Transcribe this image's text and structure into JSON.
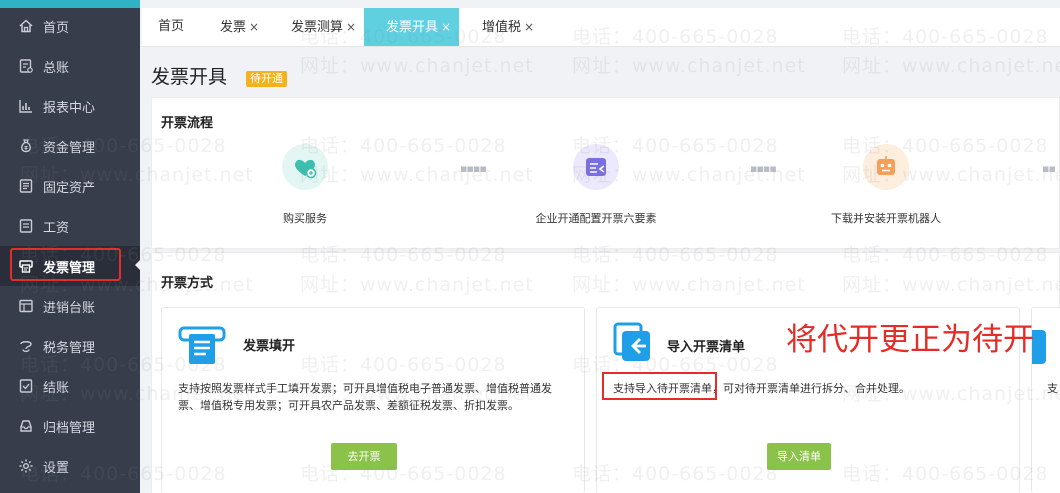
{
  "sidebar": {
    "items": [
      {
        "label": "首页",
        "icon": "home-icon"
      },
      {
        "label": "总账",
        "icon": "ledger-icon"
      },
      {
        "label": "报表中心",
        "icon": "report-chart-icon"
      },
      {
        "label": "资金管理",
        "icon": "money-bag-icon"
      },
      {
        "label": "固定资产",
        "icon": "asset-icon"
      },
      {
        "label": "工资",
        "icon": "salary-icon"
      },
      {
        "label": "发票管理",
        "icon": "invoice-printer-icon",
        "active": true
      },
      {
        "label": "进销台账",
        "icon": "stock-ledger-icon"
      },
      {
        "label": "税务管理",
        "icon": "tax-icon"
      },
      {
        "label": "结账",
        "icon": "closing-icon"
      },
      {
        "label": "归档管理",
        "icon": "archive-icon"
      },
      {
        "label": "设置",
        "icon": "gear-icon"
      }
    ]
  },
  "tabs": [
    {
      "label": "首页",
      "closable": false
    },
    {
      "label": "发票",
      "closable": true
    },
    {
      "label": "发票测算",
      "closable": true
    },
    {
      "label": "发票开具",
      "closable": true,
      "active": true
    },
    {
      "label": "增值税",
      "closable": true
    }
  ],
  "tab_close_glyph": "×",
  "page": {
    "title": "发票开具",
    "status_badge": "待开通"
  },
  "process": {
    "title": "开票流程",
    "steps": [
      {
        "label": "购买服务",
        "icon": "heart-shield-icon",
        "color": "#3bbfae"
      },
      {
        "label": "企业开通配置开票六要素",
        "icon": "config-card-icon",
        "color": "#7a6fe0"
      },
      {
        "label": "下载并安装开票机器人",
        "icon": "robot-icon",
        "color": "#f5a05a"
      }
    ]
  },
  "methods": {
    "title": "开票方式",
    "cards": [
      {
        "title": "发票填开",
        "icon": "invoice-fill-icon",
        "desc_line1": "支持按照发票样式手工填开发票；可开具增值税电子普通发票、增值税普通发",
        "desc_line2": "票、增值税专用发票；可开具农产品发票、差额征税发票、折扣发票。",
        "button": "去开票"
      },
      {
        "title": "导入开票清单",
        "icon": "import-list-icon",
        "desc_highlight": "支持导入待开票清单",
        "desc_rest": "，可对待开票清单进行拆分、合并处理。",
        "button": "导入清单"
      }
    ],
    "partial_card_text": "支"
  },
  "annotation": "将代开更正为待开",
  "watermark": {
    "phone": "电话：400-665-0028",
    "site": "网址：www.chanjet.net"
  },
  "colors": {
    "sidebar_bg": "#383d4c",
    "active_tab": "#5fd0e0",
    "badge": "#f5b21f",
    "button_green": "#8bc34a",
    "annotation_red": "#e32d26"
  }
}
